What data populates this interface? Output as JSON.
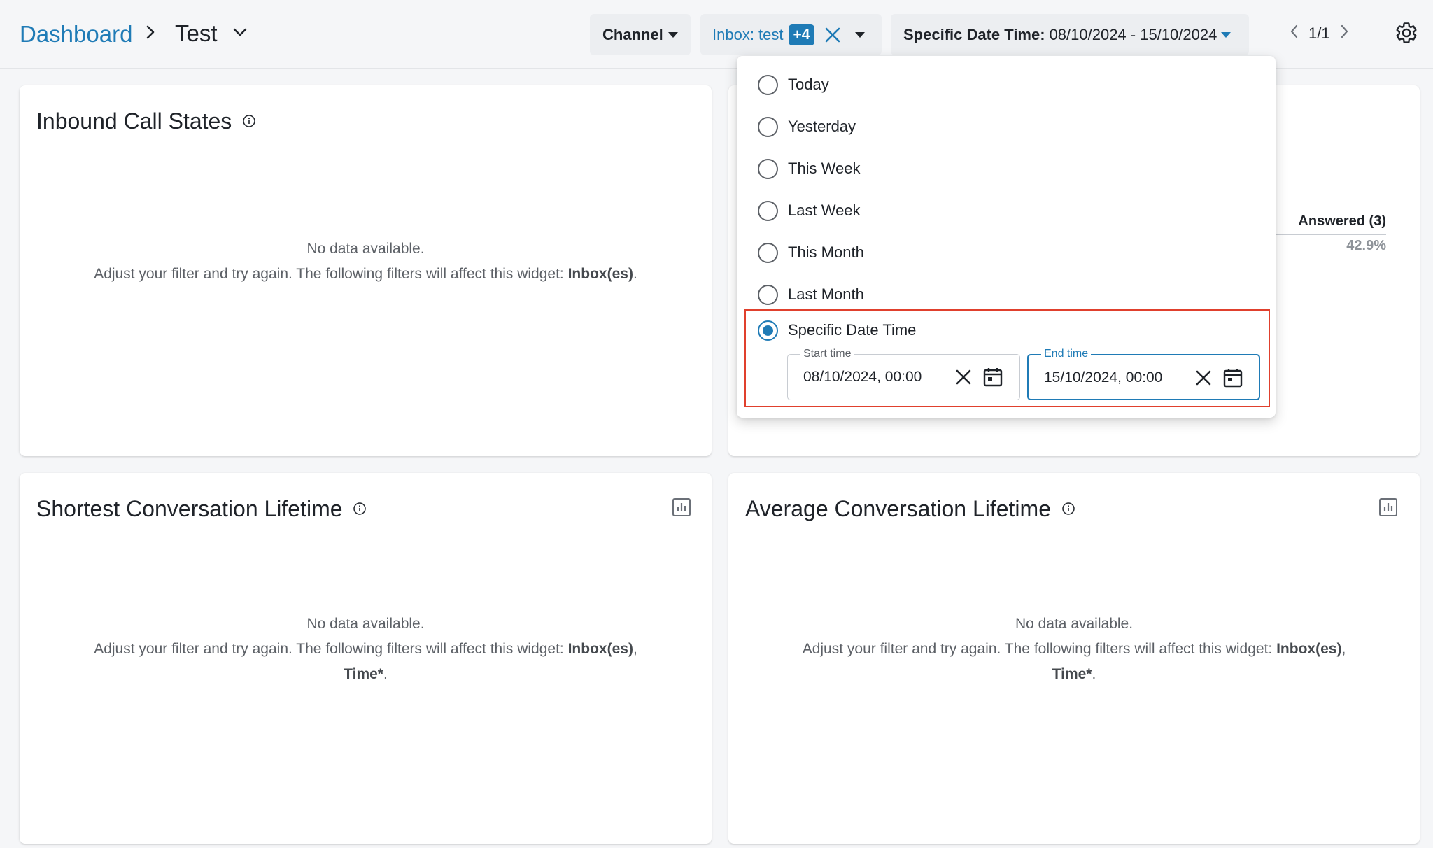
{
  "header": {
    "breadcrumb_root": "Dashboard",
    "breadcrumb_current": "Test",
    "filters": {
      "channel_label": "Channel",
      "inbox_label": "Inbox: test",
      "inbox_badge": "+4",
      "date_label": "Specific Date Time:",
      "date_value": "08/10/2024 - 15/10/2024"
    },
    "pager": "1/1"
  },
  "widgets": {
    "inbound": {
      "title": "Inbound Call States",
      "empty_line1": "No data available.",
      "empty_line2": "Adjust your filter and try again. The following filters will affect this widget:",
      "empty_filters": "Inbox(es)",
      "empty_suffix": "."
    },
    "answered": {
      "legend_name": "Answered (3)",
      "legend_pct": "42.9%"
    },
    "shortest": {
      "title": "Shortest Conversation Lifetime",
      "empty_line1": "No data available.",
      "empty_line2": "Adjust your filter and try again. The following filters will affect this widget:",
      "empty_filter_a": "Inbox(es)",
      "empty_comma": ",",
      "empty_filter_b": "Time*",
      "empty_suffix": "."
    },
    "average": {
      "title": "Average Conversation Lifetime",
      "empty_line1": "No data available.",
      "empty_line2": "Adjust your filter and try again. The following filters will affect this widget:",
      "empty_filter_a": "Inbox(es)",
      "empty_comma": ",",
      "empty_filter_b": "Time*",
      "empty_suffix": "."
    }
  },
  "date_menu": {
    "options": [
      "Today",
      "Yesterday",
      "This Week",
      "Last Week",
      "This Month",
      "Last Month",
      "Specific Date Time"
    ],
    "selected": "Specific Date Time",
    "start_label": "Start time",
    "start_value": "08/10/2024, 00:00",
    "end_label": "End time",
    "end_value": "15/10/2024, 00:00"
  },
  "colors": {
    "accent": "#1f7bb6",
    "highlight": "#e0402d"
  }
}
